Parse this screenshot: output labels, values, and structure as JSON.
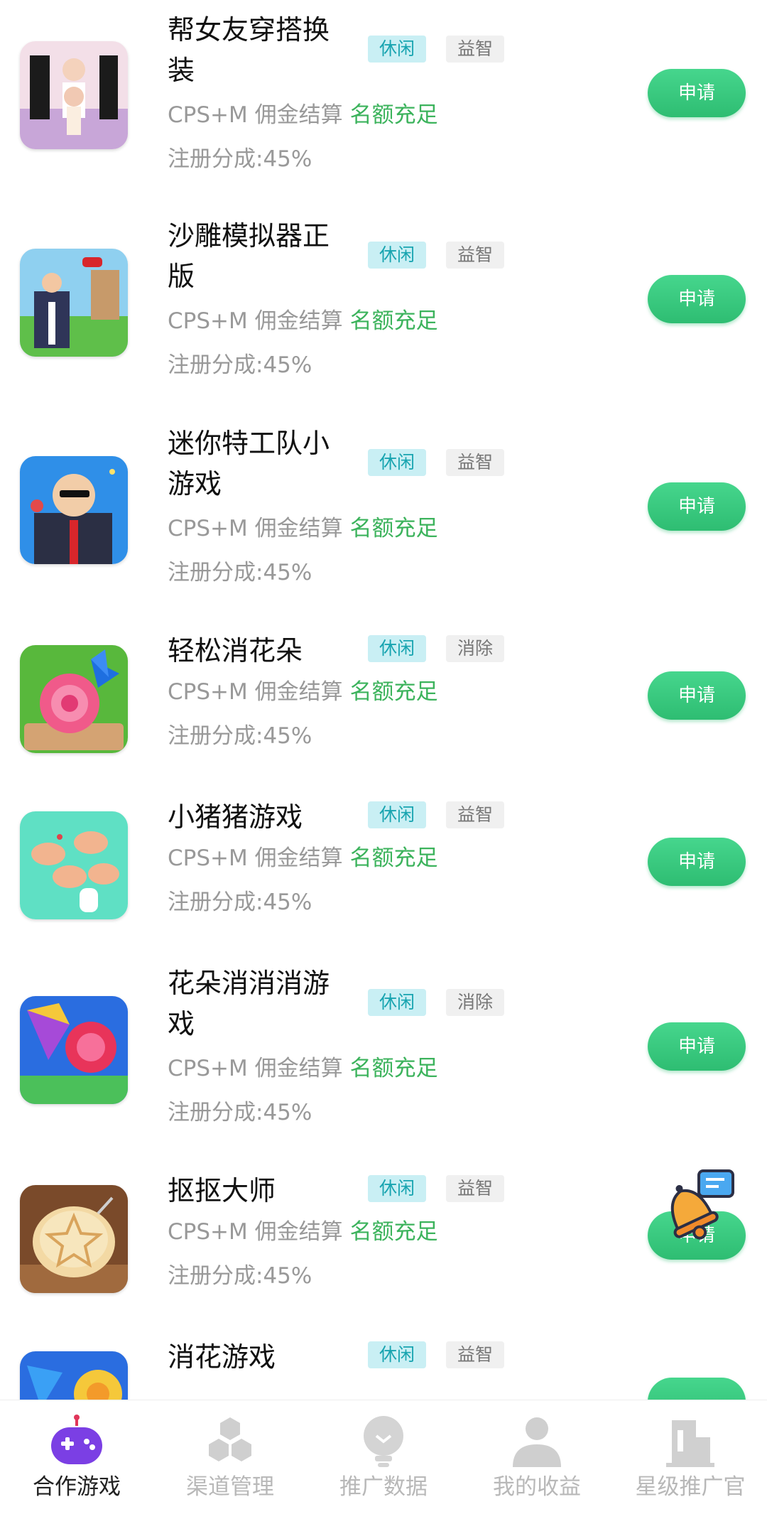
{
  "games": [
    {
      "title": "帮女友穿搭换装",
      "tags": [
        "休闲",
        "益智"
      ],
      "settlement": "CPS+M 佣金结算",
      "quota": "名额充足",
      "share": "注册分成:45%",
      "button": "申请"
    },
    {
      "title": "沙雕模拟器正版",
      "tags": [
        "休闲",
        "益智"
      ],
      "settlement": "CPS+M 佣金结算",
      "quota": "名额充足",
      "share": "注册分成:45%",
      "button": "申请"
    },
    {
      "title": "迷你特工队小游戏",
      "tags": [
        "休闲",
        "益智"
      ],
      "settlement": "CPS+M 佣金结算",
      "quota": "名额充足",
      "share": "注册分成:45%",
      "button": "申请"
    },
    {
      "title": "轻松消花朵",
      "tags": [
        "休闲",
        "消除"
      ],
      "settlement": "CPS+M 佣金结算",
      "quota": "名额充足",
      "share": "注册分成:45%",
      "button": "申请"
    },
    {
      "title": "小猪猪游戏",
      "tags": [
        "休闲",
        "益智"
      ],
      "settlement": "CPS+M 佣金结算",
      "quota": "名额充足",
      "share": "注册分成:45%",
      "button": "申请"
    },
    {
      "title": "花朵消消消游戏",
      "tags": [
        "休闲",
        "消除"
      ],
      "settlement": "CPS+M 佣金结算",
      "quota": "名额充足",
      "share": "注册分成:45%",
      "button": "申请"
    },
    {
      "title": "抠抠大师",
      "tags": [
        "休闲",
        "益智"
      ],
      "settlement": "CPS+M 佣金结算",
      "quota": "名额充足",
      "share": "注册分成:45%",
      "button": "申请"
    },
    {
      "title": "消花游戏",
      "tags": [
        "休闲",
        "益智"
      ],
      "settlement": "",
      "quota": "",
      "share": "",
      "button": ""
    }
  ],
  "tabbar": [
    {
      "label": "合作游戏",
      "icon": "gamepad-icon",
      "active": true
    },
    {
      "label": "渠道管理",
      "icon": "hexagon-cluster-icon",
      "active": false
    },
    {
      "label": "推广数据",
      "icon": "bulb-icon",
      "active": false
    },
    {
      "label": "我的收益",
      "icon": "user-icon",
      "active": false
    },
    {
      "label": "星级推广官",
      "icon": "building-icon",
      "active": false
    }
  ],
  "colors": {
    "accent": "#2ebd72",
    "quota": "#3cb35c",
    "tag_primary_bg": "#c9eff4",
    "tag_primary_fg": "#18a4b0",
    "active_tab": "#7b3fe4"
  }
}
